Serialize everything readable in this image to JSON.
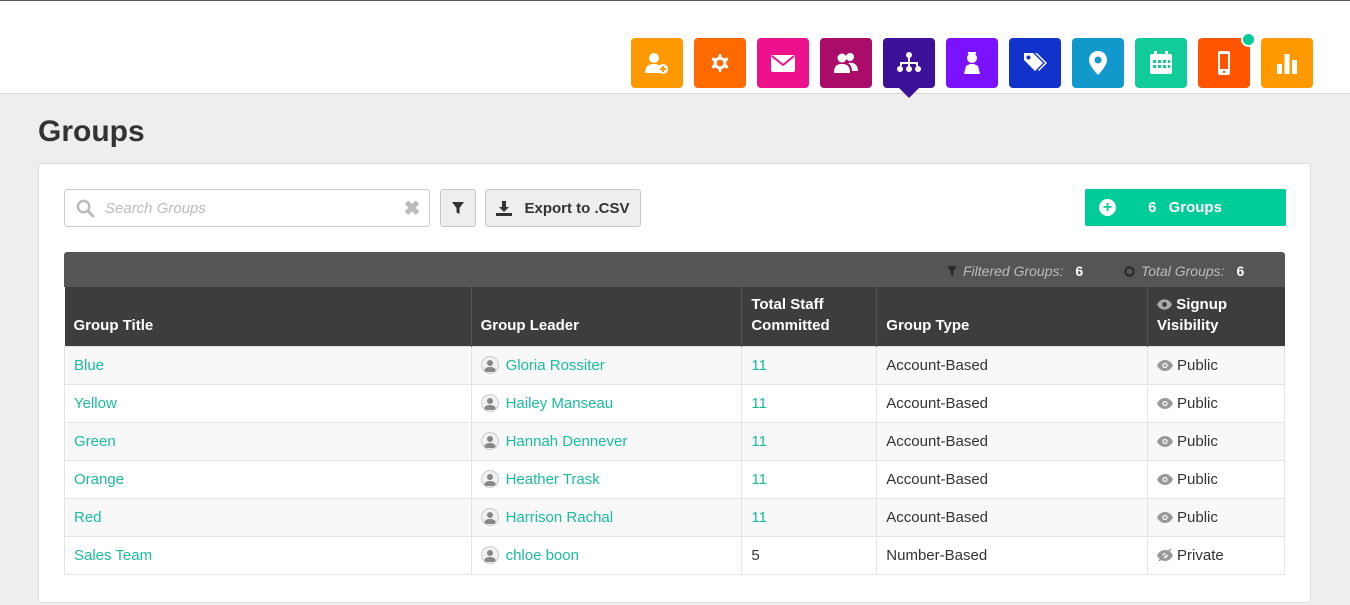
{
  "nav": {
    "icons": [
      {
        "name": "add-user-icon",
        "color": "#ff9900"
      },
      {
        "name": "gear-icon",
        "color": "#ff6a00"
      },
      {
        "name": "envelope-icon",
        "color": "#ee118c"
      },
      {
        "name": "users-icon",
        "color": "#aa0c6a"
      },
      {
        "name": "hierarchy-icon",
        "color": "#3e1199",
        "active": true
      },
      {
        "name": "chess-king-icon",
        "color": "#7a11ff"
      },
      {
        "name": "tags-icon",
        "color": "#1133cc"
      },
      {
        "name": "map-pin-icon",
        "color": "#1199cc"
      },
      {
        "name": "calendar-icon",
        "color": "#11cc99"
      },
      {
        "name": "mobile-icon",
        "color": "#ff5500",
        "notification": true
      },
      {
        "name": "bar-chart-icon",
        "color": "#ff9900"
      }
    ]
  },
  "page": {
    "title": "Groups"
  },
  "toolbar": {
    "search_placeholder": "Search Groups",
    "search_value": "",
    "export_label": "Export to .CSV",
    "groups_count": "6",
    "groups_label": "Groups"
  },
  "summary": {
    "filtered_label": "Filtered Groups:",
    "filtered_count": "6",
    "total_label": "Total Groups:",
    "total_count": "6"
  },
  "table": {
    "headers": {
      "title": "Group Title",
      "leader": "Group Leader",
      "staff_line1": "Total Staff",
      "staff_line2": "Committed",
      "type": "Group Type",
      "visibility_line1": "Signup",
      "visibility_line2": "Visibility"
    },
    "rows": [
      {
        "title": "Blue",
        "leader": "Gloria Rossiter",
        "staff": "11",
        "staff_link": true,
        "type": "Account-Based",
        "visibility": "Public"
      },
      {
        "title": "Yellow",
        "leader": "Hailey Manseau",
        "staff": "11",
        "staff_link": true,
        "type": "Account-Based",
        "visibility": "Public"
      },
      {
        "title": "Green",
        "leader": "Hannah Dennever",
        "staff": "11",
        "staff_link": true,
        "type": "Account-Based",
        "visibility": "Public"
      },
      {
        "title": "Orange",
        "leader": "Heather Trask",
        "staff": "11",
        "staff_link": true,
        "type": "Account-Based",
        "visibility": "Public"
      },
      {
        "title": "Red",
        "leader": "Harrison Rachal",
        "staff": "11",
        "staff_link": true,
        "type": "Account-Based",
        "visibility": "Public"
      },
      {
        "title": "Sales Team",
        "leader": "chloe boon",
        "staff": "5",
        "staff_link": false,
        "type": "Number-Based",
        "visibility": "Private"
      }
    ]
  }
}
